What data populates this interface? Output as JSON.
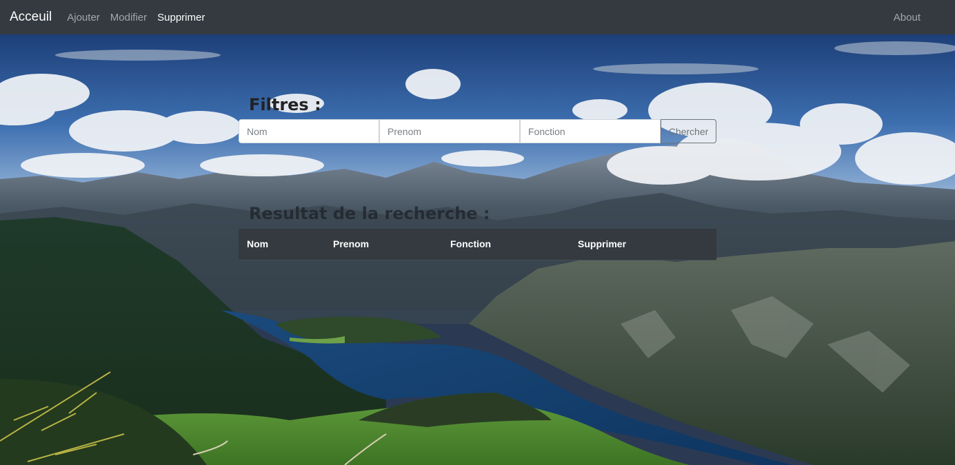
{
  "navbar": {
    "brand": "Acceuil",
    "links": [
      {
        "label": "Ajouter",
        "active": false
      },
      {
        "label": "Modifier",
        "active": false
      },
      {
        "label": "Supprimer",
        "active": true
      }
    ],
    "right_link": "About"
  },
  "filters": {
    "title": "Filtres :",
    "nom_placeholder": "Nom",
    "prenom_placeholder": "Prenom",
    "fonction_placeholder": "Fonction",
    "search_button": "Chercher"
  },
  "results": {
    "title": "Resultat de la recherche :",
    "columns": [
      "Nom",
      "Prenom",
      "Fonction",
      "Supprimer"
    ],
    "rows": []
  },
  "colors": {
    "navbar": "#343a40",
    "table_header": "#343a40"
  }
}
